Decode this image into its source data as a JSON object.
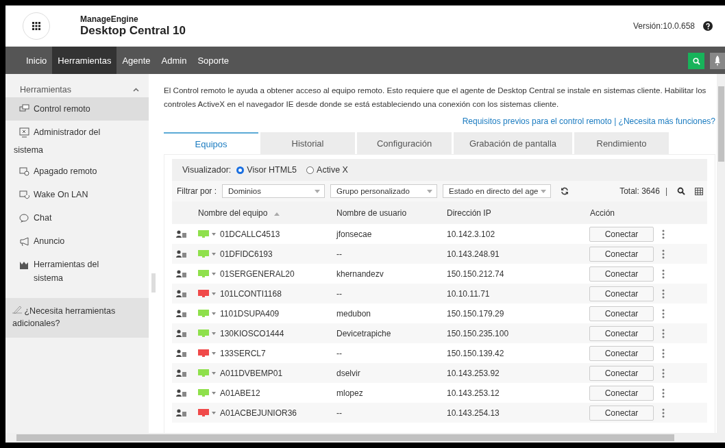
{
  "header": {
    "brand": "ManageEngine",
    "product": "Desktop Central 10",
    "version": "Versión:10.0.658"
  },
  "nav": [
    {
      "label": "Inicio",
      "selected": false
    },
    {
      "label": "Herramientas",
      "selected": true
    },
    {
      "label": "Agente",
      "selected": false
    },
    {
      "label": "Admin",
      "selected": false
    },
    {
      "label": "Soporte",
      "selected": false
    }
  ],
  "sidebar": {
    "title": "Herramientas",
    "expanded": true,
    "items": [
      {
        "label": "Control remoto",
        "selected": true
      },
      {
        "label": "Administrador del",
        "label_2": "sistema",
        "selected": false
      },
      {
        "label": "Apagado remoto",
        "selected": false
      },
      {
        "label": "Wake On LAN",
        "selected": false
      },
      {
        "label": "Chat",
        "selected": false
      },
      {
        "label": "Anuncio",
        "selected": false
      },
      {
        "label": "Herramientas del sistema",
        "selected": false
      }
    ],
    "extra": "¿Necesita herramientas adicionales?"
  },
  "intro": "El Control remoto le ayuda a obtener acceso al equipo remoto. Esto requiere que el agente de Desktop Central se instale en sistemas cliente. Habilitar los controles ActiveX en el navegador IE desde donde se está estableciendo una conexión con los sistemas cliente.",
  "links": [
    "Requisitos previos para el control remoto",
    "|",
    "¿Necesita más funciones?"
  ],
  "tabs": [
    {
      "label": "Equipos",
      "selected": true
    },
    {
      "label": "Historial",
      "selected": false
    },
    {
      "label": "Configuración",
      "selected": false
    },
    {
      "label": "Grabación de pantalla",
      "selected": false
    },
    {
      "label": "Rendimiento",
      "selected": false
    }
  ],
  "viewer": {
    "label": "Visualizador:",
    "options": [
      {
        "label": "Visor HTML5",
        "selected": true
      },
      {
        "label": "Active X",
        "selected": false
      }
    ]
  },
  "filter": {
    "label": "Filtrar por :",
    "dropdowns": [
      "Dominios",
      "Grupo personalizado",
      "Estado en directo del age"
    ],
    "total": "Total: 3646",
    "separator": "|"
  },
  "table": {
    "columns": [
      "Nombre del equipo",
      "Nombre de usuario",
      "Dirección IP",
      "Acción"
    ],
    "rows": [
      {
        "name": "01DCALLC4513",
        "user": "jfonsecae",
        "ip": "10.142.3.102",
        "color": "#8fe04c",
        "action": "Conectar"
      },
      {
        "name": "01DFIDC6193",
        "user": "--",
        "ip": "10.143.248.91",
        "color": "#8fe04c",
        "action": "Conectar"
      },
      {
        "name": "01SERGENERAL20",
        "user": "khernandezv",
        "ip": "150.150.212.74",
        "color": "#8fe04c",
        "action": "Conectar"
      },
      {
        "name": "101LCONTI1168",
        "user": "--",
        "ip": "10.10.11.71",
        "color": "#f04a4a",
        "action": "Conectar"
      },
      {
        "name": "1101DSUPA409",
        "user": "medubon",
        "ip": "150.150.179.29",
        "color": "#8fe04c",
        "action": "Conectar"
      },
      {
        "name": "130KIOSCO1444",
        "user": "Devicetrapiche",
        "ip": "150.150.235.100",
        "color": "#8fe04c",
        "action": "Conectar"
      },
      {
        "name": "133SERCL7",
        "user": "--",
        "ip": "150.150.139.42",
        "color": "#f04a4a",
        "action": "Conectar"
      },
      {
        "name": "A011DVBEMP01",
        "user": "dselvir",
        "ip": "10.143.253.92",
        "color": "#8fe04c",
        "action": "Conectar"
      },
      {
        "name": "A01ABE12",
        "user": "mlopez",
        "ip": "10.143.253.12",
        "color": "#8fe04c",
        "action": "Conectar"
      },
      {
        "name": "A01ACBEJUNIOR36",
        "user": "--",
        "ip": "10.143.254.13",
        "color": "#f04a4a",
        "action": "Conectar"
      }
    ]
  }
}
